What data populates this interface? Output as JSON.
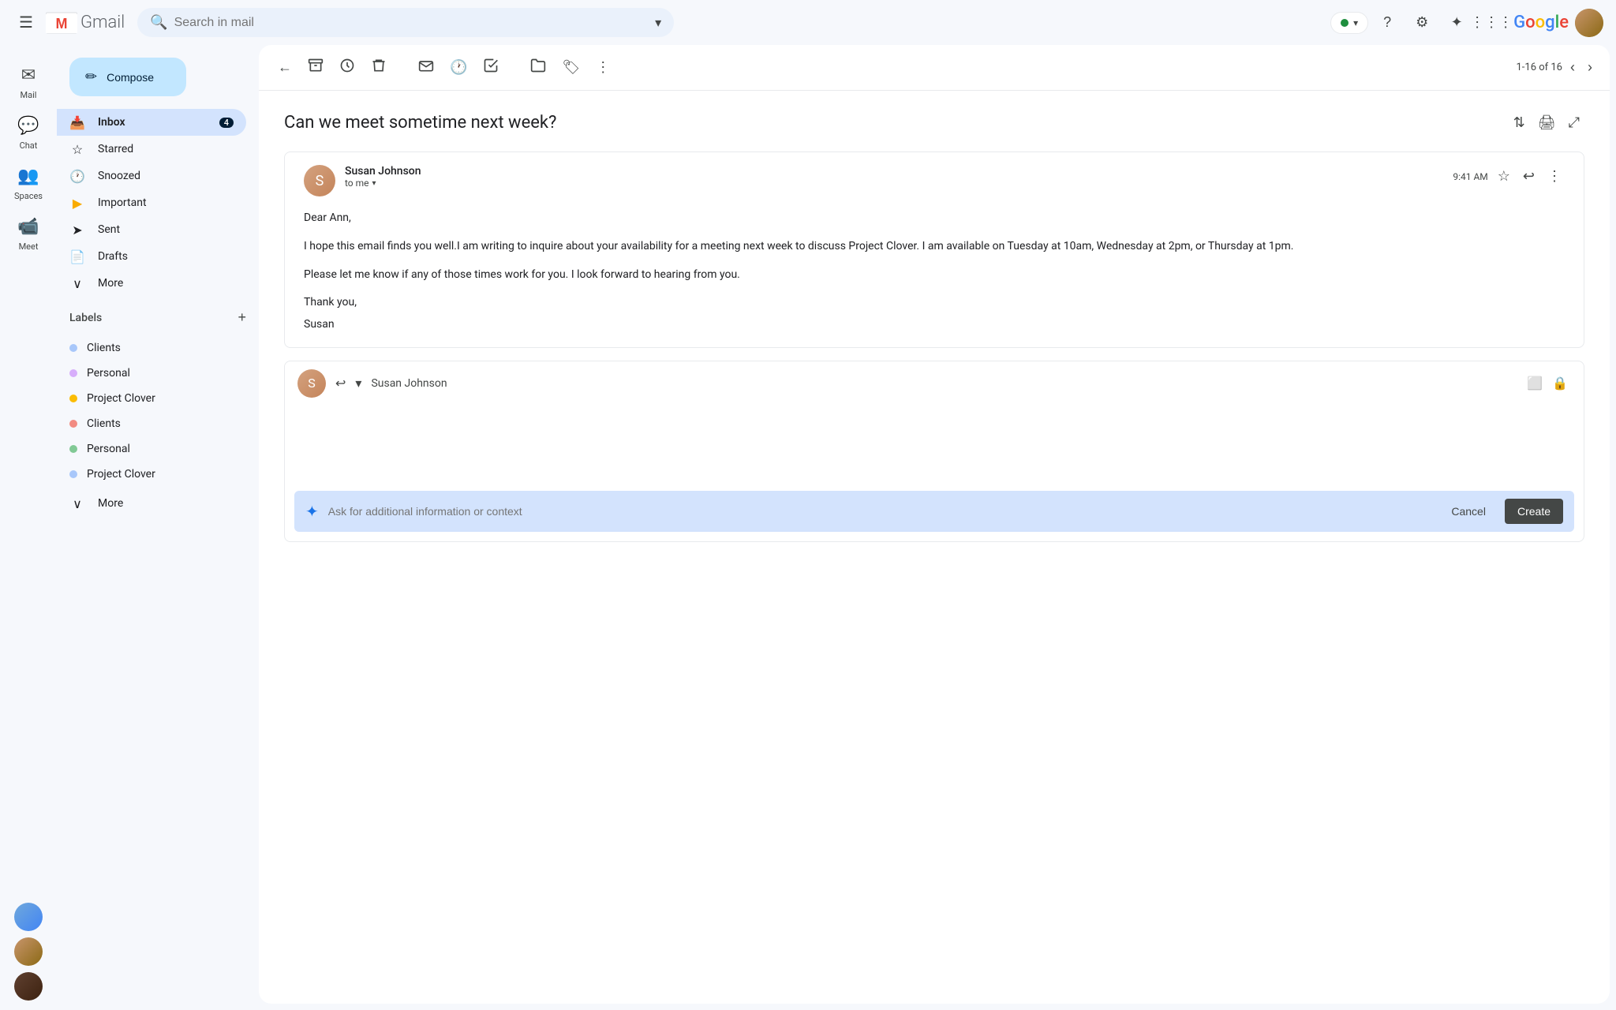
{
  "app": {
    "title": "Gmail",
    "logo_letter": "M"
  },
  "topbar": {
    "search_placeholder": "Search in mail",
    "status_label": "Active",
    "help_icon": "?",
    "settings_icon": "⚙",
    "gemini_icon": "✦",
    "apps_icon": "⋮⋮⋮",
    "google_text": "Google"
  },
  "sidebar": {
    "compose_label": "Compose",
    "nav_items": [
      {
        "id": "mail",
        "label": "Mail",
        "icon": "✉",
        "active": false
      },
      {
        "id": "inbox",
        "label": "Inbox",
        "icon": "📥",
        "badge": "4",
        "active": true
      },
      {
        "id": "chat",
        "label": "Chat",
        "icon": "💬",
        "active": false
      },
      {
        "id": "starred",
        "label": "Starred",
        "icon": "☆",
        "active": false
      },
      {
        "id": "snoozed",
        "label": "Snoozed",
        "icon": "🕐",
        "active": false
      },
      {
        "id": "important",
        "label": "Important",
        "icon": "➤",
        "active": false
      },
      {
        "id": "sent",
        "label": "Sent",
        "icon": "➤",
        "active": false
      },
      {
        "id": "drafts",
        "label": "Drafts",
        "icon": "📄",
        "active": false
      }
    ],
    "more_label_1": "More",
    "labels_title": "Labels",
    "labels": [
      {
        "id": "clients-1",
        "label": "Clients",
        "color": "#a8c7fa"
      },
      {
        "id": "personal-1",
        "label": "Personal",
        "color": "#d7aefb"
      },
      {
        "id": "project-clover-1",
        "label": "Project Clover",
        "color": "#fbbc04"
      },
      {
        "id": "clients-2",
        "label": "Clients",
        "color": "#f28b82"
      },
      {
        "id": "personal-2",
        "label": "Personal",
        "color": "#81c995"
      },
      {
        "id": "project-clover-2",
        "label": "Project Clover",
        "color": "#a8c7fa"
      }
    ],
    "more_label_2": "More"
  },
  "left_icons": [
    {
      "id": "mail",
      "icon": "✉",
      "label": "Mail"
    },
    {
      "id": "chat",
      "icon": "💬",
      "label": "Chat"
    },
    {
      "id": "spaces",
      "icon": "👥",
      "label": "Spaces"
    },
    {
      "id": "meet",
      "icon": "📹",
      "label": "Meet"
    }
  ],
  "toolbar": {
    "back_icon": "←",
    "archive_icon": "📦",
    "snooze_icon": "⏰",
    "delete_icon": "🗑",
    "mark_icon": "✉",
    "history_icon": "🕐",
    "task_icon": "✓",
    "move_icon": "📁",
    "label_icon": "🏷",
    "more_icon": "⋮",
    "count": "1-16 of 16",
    "prev_icon": "‹",
    "next_icon": "›"
  },
  "email": {
    "subject": "Can we meet sometime next week?",
    "sender_name": "Susan Johnson",
    "sender_to": "to me",
    "time": "9:41 AM",
    "body_greeting": "Dear Ann,",
    "body_p1": "I hope this email finds you well.I am writing to inquire about your availability for a meeting next week to discuss Project Clover. I am available on Tuesday at 10am, Wednesday at 2pm, or Thursday at 1pm.",
    "body_p2": "Please let me know if any of those times work for you. I look forward to hearing from you.",
    "body_p3": "Thank you,",
    "body_p4": "Susan"
  },
  "reply": {
    "recipient": "Susan Johnson",
    "reply_icon": "↩",
    "forward_icon": "▾",
    "expand_icon": "⬜",
    "lock_icon": "🔒"
  },
  "ai_bar": {
    "placeholder": "Ask for additional information or context",
    "cancel_label": "Cancel",
    "create_label": "Create",
    "ai_icon": "✦"
  },
  "avatars": [
    {
      "id": "avatar-1",
      "color": "#8ab4f8",
      "letter": ""
    },
    {
      "id": "avatar-2",
      "color": "#d4a27f",
      "letter": ""
    },
    {
      "id": "avatar-3",
      "color": "#6d5b4e",
      "letter": ""
    }
  ]
}
